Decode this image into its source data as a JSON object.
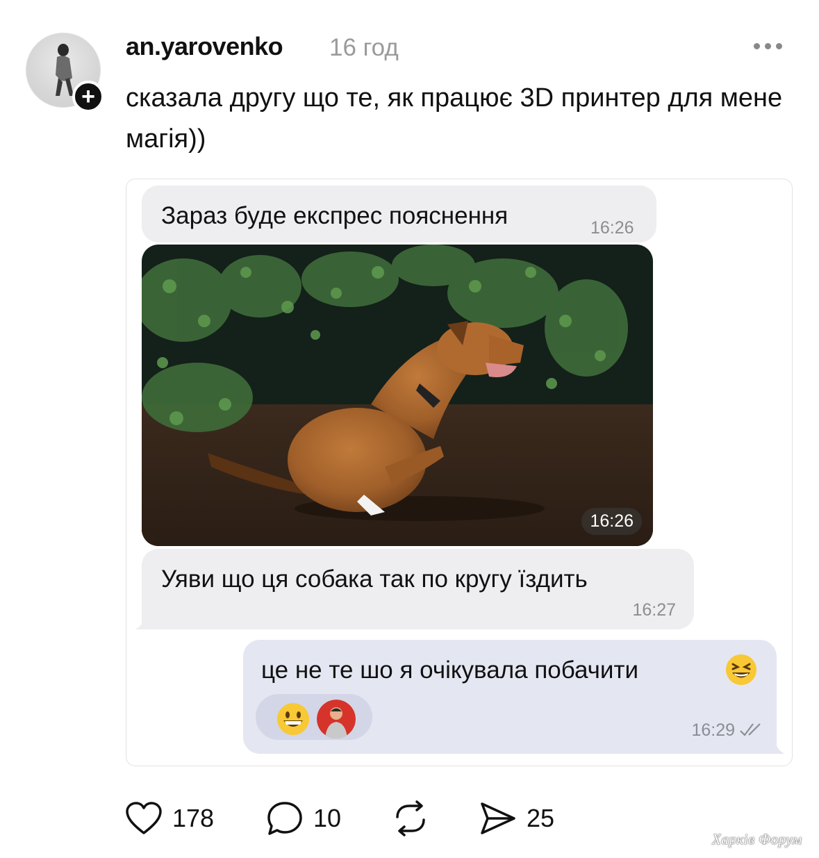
{
  "post": {
    "username": "an.yarovenko",
    "time_ago": "16 год",
    "caption": "сказала другу що те, як працює 3D принтер для мене магія))",
    "avatar_icon": "user-avatar",
    "follow_icon": "plus-icon",
    "more_icon": "more-dots-icon"
  },
  "chat": {
    "messages": [
      {
        "text": "Зараз буде експрес пояснення",
        "time": "16:26"
      },
      {
        "image_alt": "dog-photo",
        "time": "16:26"
      },
      {
        "text": "Уяви що ця собака так по кругу їздить",
        "time": "16:27"
      },
      {
        "text": "це не те шо я очікувала побачити",
        "time": "16:29",
        "emoji": "laughing-emoji",
        "reaction": "grinning-emoji"
      }
    ],
    "colors": {
      "incoming": "#eeeef0",
      "outgoing": "#e4e6f1",
      "timestamp": "#8c8c93"
    }
  },
  "actions": {
    "likes": "178",
    "comments": "10",
    "shares": "25",
    "icons": [
      "heart-icon",
      "comment-icon",
      "repost-icon",
      "send-icon"
    ]
  },
  "watermark": "Харків Форум"
}
